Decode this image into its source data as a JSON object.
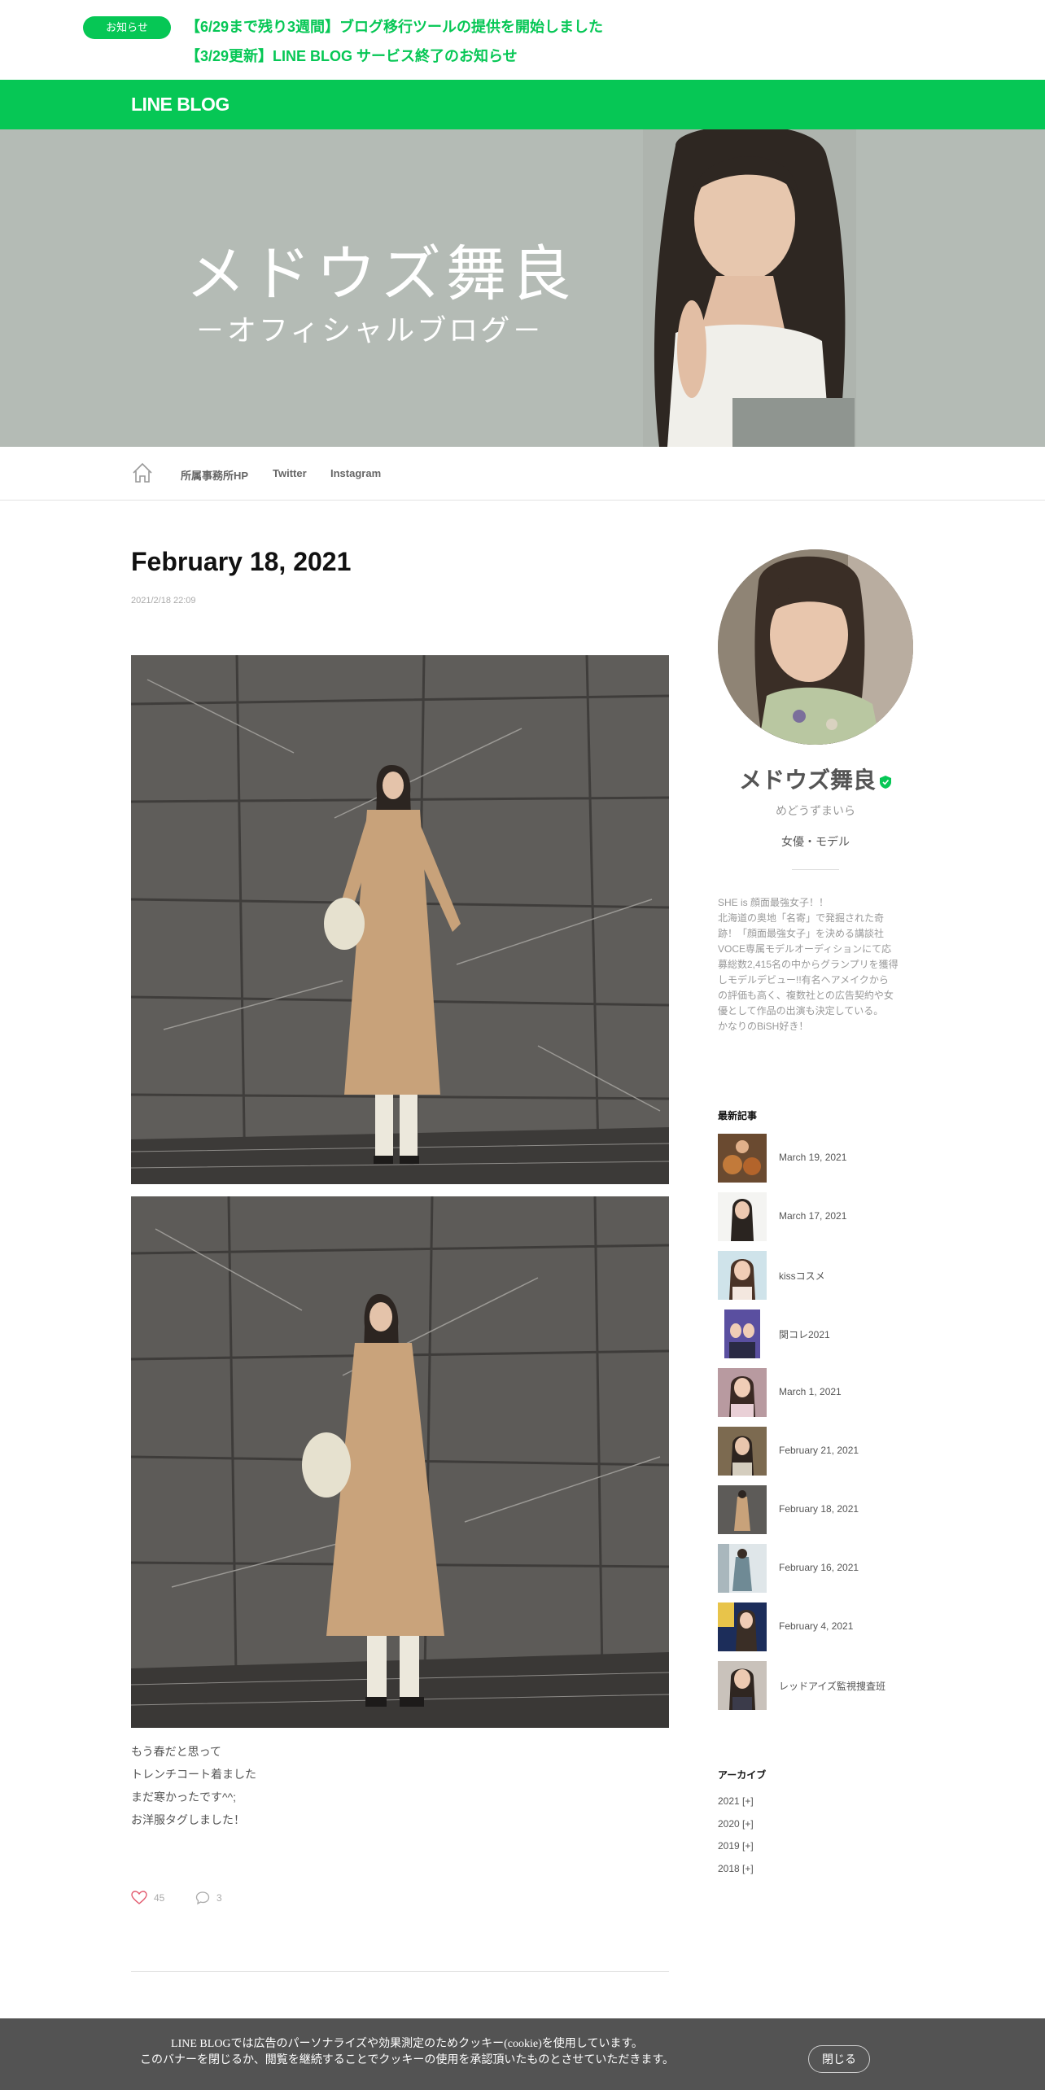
{
  "notices": {
    "badge": "お知らせ",
    "items": [
      "【6/29まで残り3週間】ブログ移行ツールの提供を開始しました",
      "【3/29更新】LINE BLOG サービス終了のお知らせ"
    ]
  },
  "header": {
    "logo": "LINE BLOG",
    "brand_color": "#06c755"
  },
  "banner": {
    "title": "メドウズ舞良",
    "subtitle": "－オフィシャルブログ－",
    "background_color": "#b4bbb5"
  },
  "nav": {
    "home_icon": "home-icon",
    "links": [
      "所属事務所HP",
      "Twitter",
      "Instagram"
    ]
  },
  "article": {
    "title": "February 18, 2021",
    "date": "2021/2/18 22:09",
    "body": [
      "もう春だと思って",
      "トレンチコート着ました",
      "まだ寒かったです^^;",
      "お洋服タグしました！"
    ],
    "likes": "45",
    "comments": "3"
  },
  "profile": {
    "name": "メドウズ舞良",
    "kana": "めどうずまいら",
    "role": "女優・モデル",
    "bio": [
      "SHE is 顔面最強女子！！",
      "北海道の奥地「名寄」で発掘された奇",
      "跡！「顔面最強女子」を決める講談社",
      "VOCE専属モデルオーディションにて応",
      "募総数2,415名の中からグランプリを獲得",
      "しモデルデビュー!!有名ヘアメイクから",
      "の評価も高く、複数社との広告契約や女",
      "優として作品の出演も決定している。",
      "かなりのBiSH好き！"
    ]
  },
  "recent": {
    "heading": "最新記事",
    "items": [
      "March 19, 2021",
      "March 17, 2021",
      "kissコスメ",
      "関コレ2021",
      "March 1, 2021",
      "February 21, 2021",
      "February 18, 2021",
      "February 16, 2021",
      "February 4, 2021",
      "レッドアイズ監視捜査班"
    ]
  },
  "archive": {
    "heading": "アーカイブ",
    "items": [
      "2021 [+]",
      "2020 [+]",
      "2019 [+]",
      "2018 [+]"
    ]
  },
  "cookie": {
    "line1": "LINE BLOGでは広告のパーソナライズや効果測定のためクッキー(cookie)を使用しています。",
    "line2": "このバナーを閉じるか、閲覧を継続することでクッキーの使用を承認頂いたものとさせていただきます。",
    "close": "閉じる"
  }
}
